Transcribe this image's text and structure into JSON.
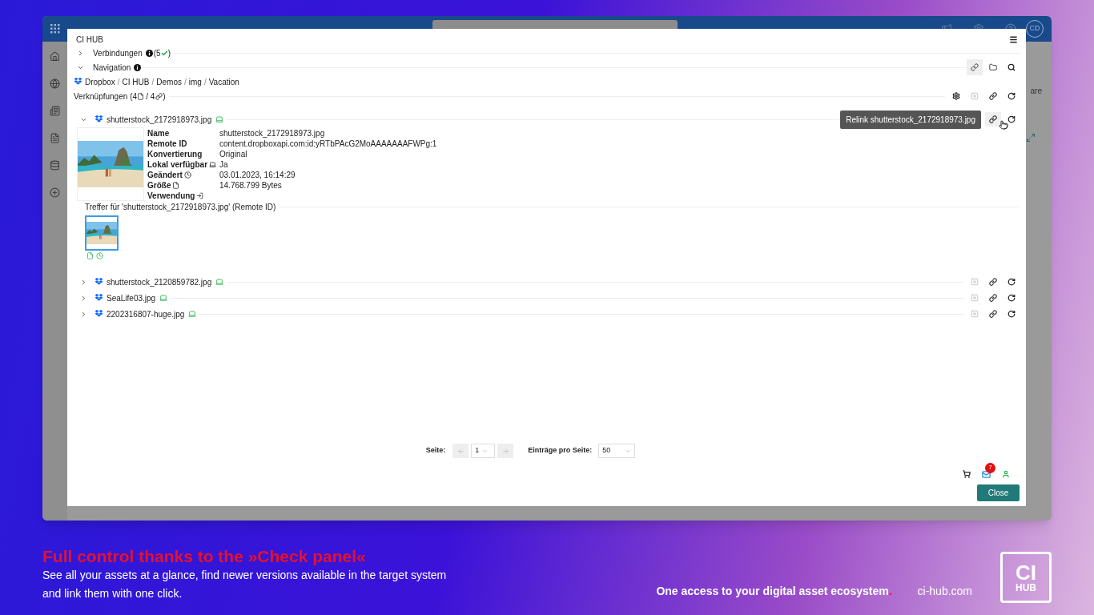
{
  "host": {
    "avatar": "CD",
    "partial_text": "are"
  },
  "panel": {
    "title": "CI HUB",
    "sections": [
      {
        "label": "Verbindungen",
        "count_open": "(5",
        "count_close": ")",
        "expanded": false
      },
      {
        "label": "Navigation",
        "expanded": true
      }
    ],
    "nav_buttons": [
      {
        "kind": "link",
        "selected": true
      },
      {
        "kind": "folder",
        "selected": false
      },
      {
        "kind": "search",
        "selected": false
      }
    ],
    "breadcrumb": {
      "separator": "/",
      "items": [
        "Dropbox",
        "CI HUB",
        "Demos",
        "img",
        "Vacation"
      ]
    },
    "links_header": {
      "label": "Verknüpfungen",
      "files": "(4",
      "links": "/ 4",
      "close": ")"
    },
    "assets": [
      {
        "name": "shutterstock_2172918973.jpg",
        "expanded": true,
        "hovered": true,
        "tooltip": "Relink shutterstock_2172918973.jpg",
        "details": [
          {
            "label": "Name",
            "value": "shutterstock_2172918973.jpg"
          },
          {
            "label": "Remote ID",
            "value": "content.dropboxapi.com:id:yRTbPAcG2MoAAAAAAAFWPg:1"
          },
          {
            "label": "Konvertierung",
            "value": "Original"
          },
          {
            "label": "Lokal verfügbar",
            "value": "Ja"
          },
          {
            "label": "Geändert",
            "value": "03.01.2023, 16:14:29"
          },
          {
            "label": "Größe",
            "value": "14.768.799 Bytes"
          },
          {
            "label": "Verwendung"
          }
        ],
        "matches_label": "Treffer für 'shutterstock_2172918973.jpg' (Remote ID)",
        "matches": [
          {
            "selected": true
          }
        ]
      },
      {
        "name": "shutterstock_2120859782.jpg",
        "expanded": false,
        "hovered": false
      },
      {
        "name": "SeaLife03.jpg",
        "expanded": false,
        "hovered": false
      },
      {
        "name": "2202316807-huge.jpg",
        "expanded": false,
        "hovered": false
      }
    ],
    "pagination": {
      "page_label": "Seite:",
      "page": "1",
      "per_page_label": "Einträge pro Seite:",
      "per_page": "50"
    },
    "notifications": "7",
    "close": "Close"
  },
  "caption": {
    "title": "Full control thanks to the »Check panel«",
    "lines": [
      "See all your assets at a glance, find newer versions available in the target system",
      "and link them with one click."
    ],
    "tagline": "One access to your digital asset ecosystem",
    "tagline_mark": ".",
    "site": "ci-hub.com",
    "logo_top": "CI",
    "logo_bottom": "HUB"
  }
}
